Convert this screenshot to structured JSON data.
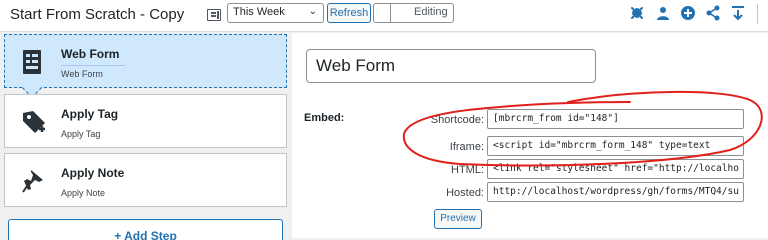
{
  "header": {
    "title": "Start From Scratch - Copy",
    "range_select": "This Week",
    "refresh_label": "Refresh",
    "mode_label": "Editing",
    "tool_icons": [
      "collapse-icon",
      "user-icon",
      "add-circle-icon",
      "share-icon",
      "export-icon"
    ]
  },
  "steps": [
    {
      "name": "Web Form",
      "type": "Web Form",
      "icon": "form-icon",
      "active": true
    },
    {
      "name": "Apply Tag",
      "type": "Apply Tag",
      "icon": "tag-plus-icon",
      "active": false
    },
    {
      "name": "Apply Note",
      "type": "Apply Note",
      "icon": "pushpin-icon",
      "active": false
    }
  ],
  "add_step_label": "+ Add Step",
  "form": {
    "name_value": "Web Form",
    "embed_label": "Embed:",
    "shortcode_label": "Shortcode:",
    "shortcode_value": "[mbrcrm_from id=\"148\"]",
    "iframe_label": "Iframe:",
    "iframe_value": "<script id=\"mbrcrm_form_148\" type=text",
    "html_label": "HTML:",
    "html_value": "<link rel=\"stylesheet\" href=\"http://localho",
    "hosted_label": "Hosted:",
    "hosted_value": "http://localhost/wordpress/gh/forms/MTQ4/su",
    "preview_label": "Preview"
  },
  "colors": {
    "accent": "#2271b1",
    "active_step_bg": "#cfe8fc",
    "annotation": "#e0201b"
  }
}
